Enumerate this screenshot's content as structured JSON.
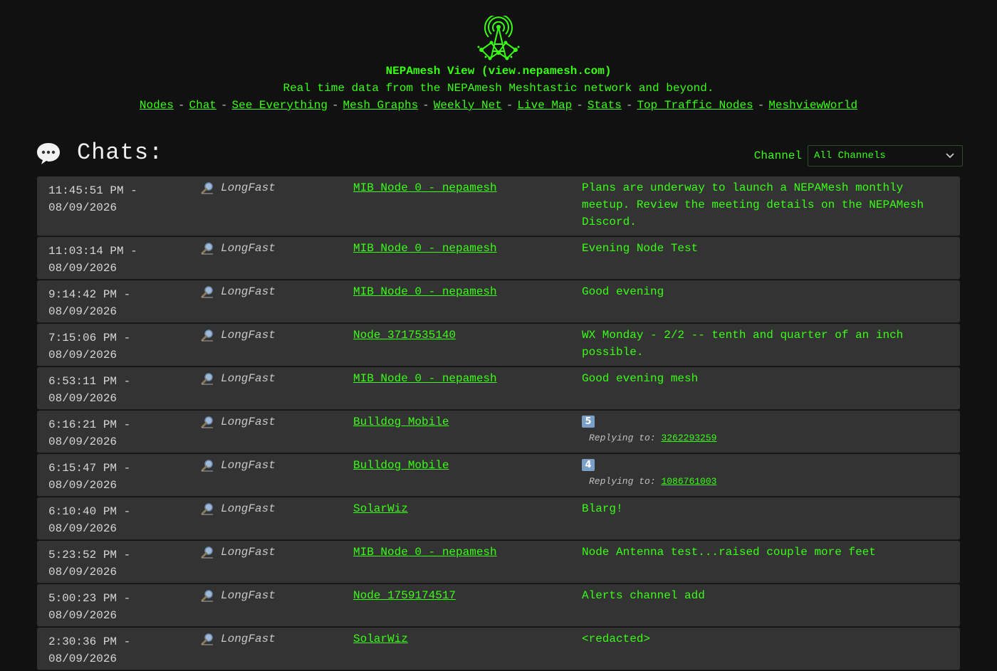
{
  "header": {
    "title": "NEPAmesh View (view.nepamesh.com)",
    "tagline": "Real time data from the NEPAmesh Meshtastic network and beyond.",
    "nav": [
      "Nodes",
      "Chat",
      "See Everything",
      "Mesh Graphs",
      "Weekly Net",
      "Live Map",
      "Stats",
      "Top Traffic Nodes",
      "MeshviewWorld"
    ],
    "separator": "-"
  },
  "chats": {
    "title": "Chats:",
    "channel_label": "Channel",
    "channel_value": "All Channels"
  },
  "reply_label": "Replying to:",
  "messages": [
    {
      "time": "11:45:51 PM -",
      "date": "08/09/2026",
      "channel": "LongFast",
      "node": "MIB Node 0 - nepamesh",
      "text": "Plans are underway to launch a NEPAMesh monthly meetup. Review the meeting details on the NEPAMesh Discord."
    },
    {
      "time": "11:03:14 PM -",
      "date": "08/09/2026",
      "channel": "LongFast",
      "node": "MIB Node 0 - nepamesh",
      "text": "Evening Node Test"
    },
    {
      "time": "9:14:42 PM -",
      "date": "08/09/2026",
      "channel": "LongFast",
      "node": "MIB Node 0 - nepamesh",
      "text": "Good evening"
    },
    {
      "time": "7:15:06 PM -",
      "date": "08/09/2026",
      "channel": "LongFast",
      "node": "Node 3717535140",
      "text": "WX Monday - 2/2 -- tenth and quarter of an inch possible."
    },
    {
      "time": "6:53:11 PM -",
      "date": "08/09/2026",
      "channel": "LongFast",
      "node": "MIB Node 0 - nepamesh",
      "text": "Good evening mesh"
    },
    {
      "time": "6:16:21 PM -",
      "date": "08/09/2026",
      "channel": "LongFast",
      "node": "Bulldog Mobile",
      "emoji": "5",
      "reply_to": "3262293259"
    },
    {
      "time": "6:15:47 PM -",
      "date": "08/09/2026",
      "channel": "LongFast",
      "node": "Bulldog Mobile",
      "emoji": "4",
      "reply_to": "1086761003"
    },
    {
      "time": "6:10:40 PM -",
      "date": "08/09/2026",
      "channel": "LongFast",
      "node": "SolarWiz",
      "text": "Blarg!"
    },
    {
      "time": "5:23:52 PM -",
      "date": "08/09/2026",
      "channel": "LongFast",
      "node": "MIB Node 0 - nepamesh",
      "text": "Node Antenna test...raised couple more feet"
    },
    {
      "time": "5:00:23 PM -",
      "date": "08/09/2026",
      "channel": "LongFast",
      "node": "Node 1759174517",
      "text": "Alerts channel add"
    },
    {
      "time": "2:30:36 PM -",
      "date": "08/09/2026",
      "channel": "LongFast",
      "node": "SolarWiz",
      "text": "<redacted>"
    }
  ],
  "icons": {
    "logo": "radio-tower-network-logo",
    "chats": "speech-bubble-icon",
    "channel": "magnifier-icon",
    "select": "chevron-down-icon"
  },
  "colors": {
    "accent": "#39ff14",
    "background": "#111111",
    "row": "#333333"
  }
}
